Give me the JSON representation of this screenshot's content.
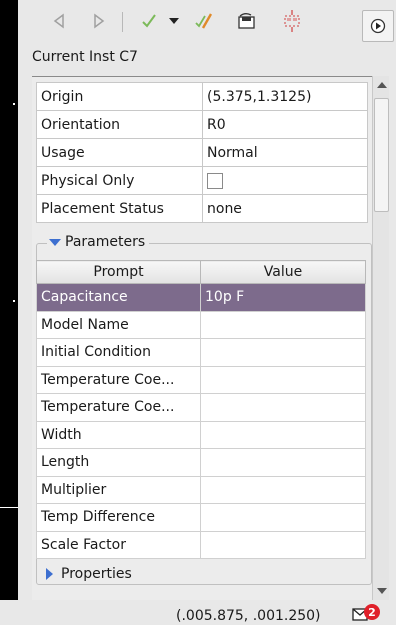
{
  "toolbar": {
    "buttons": [
      "back-icon",
      "forward-icon",
      "checkmark-icon",
      "dropdown-arrow-icon",
      "edit-clear-icon",
      "save-icon",
      "placement-icon",
      "menu-icon"
    ]
  },
  "instance_label": "Current Inst C7",
  "attributes": [
    {
      "key": "Origin",
      "value": "(5.375,1.3125)"
    },
    {
      "key": "Orientation",
      "value": "R0"
    },
    {
      "key": "Usage",
      "value": "Normal"
    },
    {
      "key": "Physical Only",
      "value": ""
    },
    {
      "key": "Placement Status",
      "value": "none"
    }
  ],
  "parameters": {
    "title": "Parameters",
    "columns": [
      "Prompt",
      "Value"
    ],
    "rows": [
      {
        "prompt": "Capacitance",
        "value": "10p F"
      },
      {
        "prompt": "Model Name",
        "value": ""
      },
      {
        "prompt": "Initial Condition",
        "value": ""
      },
      {
        "prompt": "Temperature Coe...",
        "value": ""
      },
      {
        "prompt": "Temperature Coe...",
        "value": ""
      },
      {
        "prompt": "Width",
        "value": ""
      },
      {
        "prompt": "Length",
        "value": ""
      },
      {
        "prompt": "Multiplier",
        "value": ""
      },
      {
        "prompt": "Temp Difference",
        "value": ""
      },
      {
        "prompt": "Scale Factor",
        "value": ""
      }
    ]
  },
  "properties_label": "Properties",
  "status": {
    "coords": "(.005.875, .001.250)",
    "badge_count": "2"
  },
  "colors": {
    "selection": "#7d6b8c",
    "accent": "#3d6fd0",
    "badge": "#e0202a"
  }
}
